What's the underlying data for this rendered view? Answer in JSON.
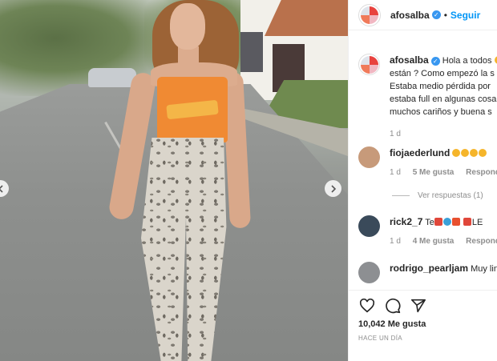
{
  "post": {
    "username": "afosalba",
    "follow_label": "Seguir",
    "separator": "•"
  },
  "caption": {
    "username": "afosalba",
    "lines": [
      "Hola a todos",
      "están ? Como empezó la s",
      "Estaba medio pérdida por",
      "estaba full en algunas cosa",
      "muchos cariños y buena s"
    ],
    "time": "1 d"
  },
  "comments": [
    {
      "username": "fiojaederlund",
      "time": "1 d",
      "likes": "5 Me gusta",
      "reply_label": "Responder"
    },
    {
      "username": "rick2_7",
      "text_prefix": "Te",
      "text_suffix": "LE",
      "time": "1 d",
      "likes": "4 Me gusta",
      "reply_label": "Responder"
    },
    {
      "username": "rodrigo_pearljam",
      "text": "Muy lin"
    }
  ],
  "view_replies": "Ver respuestas (1)",
  "likes_count": "10,042 Me gusta",
  "timestamp": "HACE UN DÍA",
  "icons": {
    "like": "heart-icon",
    "comment": "comment-icon",
    "share": "share-icon",
    "next": "chevron-right-icon",
    "prev": "chevron-left-icon",
    "verified": "verified-badge-icon"
  },
  "colors": {
    "follow": "#0095f6",
    "verified": "#3897f0",
    "meta": "#8e8e8e"
  }
}
